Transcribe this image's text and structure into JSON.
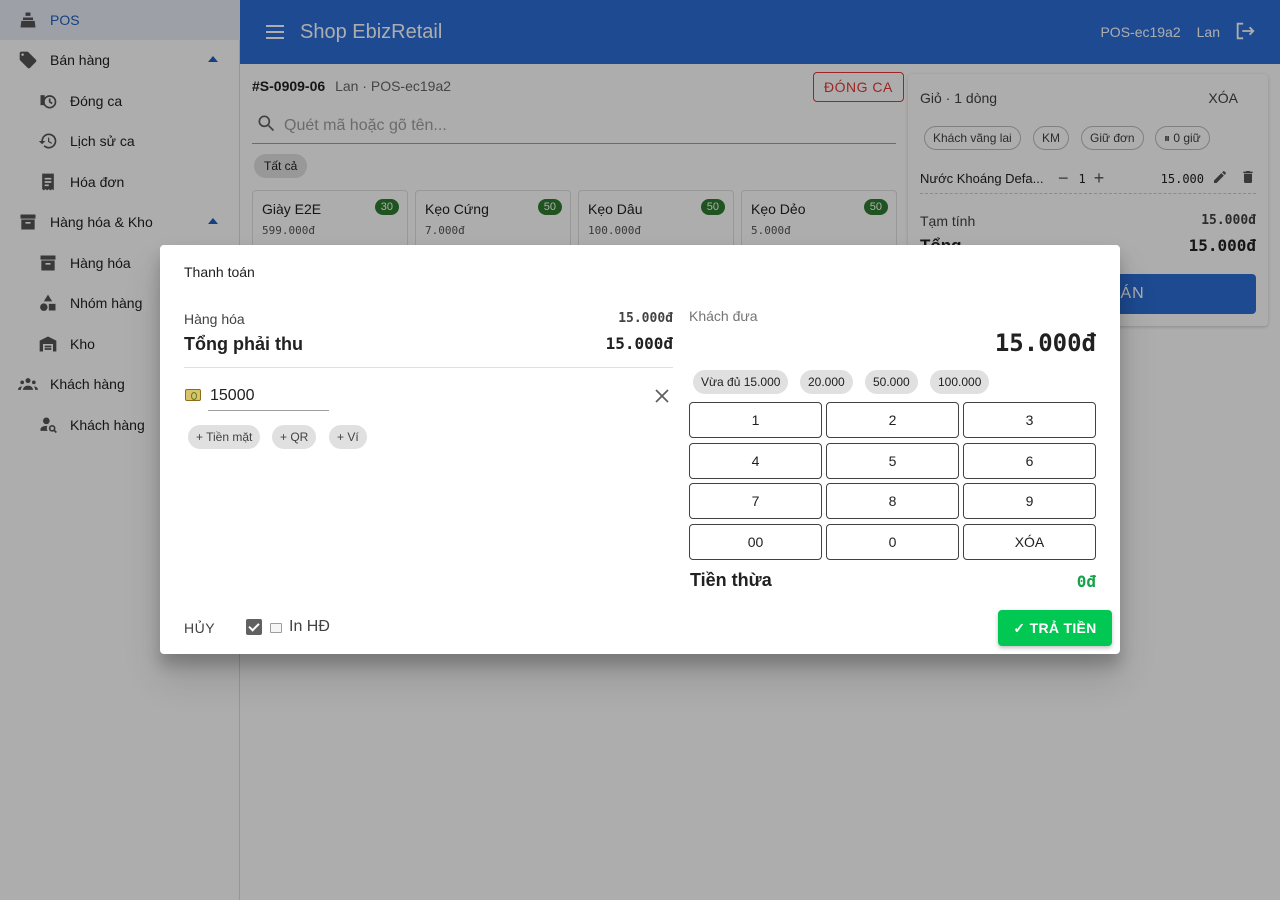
{
  "sidebar": {
    "pos": "POS",
    "sales": "Bán hàng",
    "close_shift": "Đóng ca",
    "shift_history": "Lịch sử ca",
    "invoices": "Hóa đơn",
    "goods_stock": "Hàng hóa & Kho",
    "goods": "Hàng hóa",
    "groups": "Nhóm hàng",
    "warehouse": "Kho",
    "customers_group": "Khách hàng",
    "customers": "Khách hàng"
  },
  "appbar": {
    "title": "Shop EbizRetail",
    "terminal": "POS-ec19a2",
    "user": "Lan"
  },
  "order": {
    "code": "#S-0909-06",
    "meta": "Lan · POS-ec19a2",
    "close_shift_btn": "ĐÓNG CA"
  },
  "search": {
    "placeholder": "Quét mã hoặc gõ tên..."
  },
  "filter": {
    "all": "Tất cả"
  },
  "products": [
    {
      "name": "Giày E2E",
      "price": "599.000đ",
      "stock": "30"
    },
    {
      "name": "Kẹo Cứng",
      "price": "7.000đ",
      "stock": "50"
    },
    {
      "name": "Kẹo Dâu",
      "price": "100.000đ",
      "stock": "50"
    },
    {
      "name": "Kẹo Dẻo",
      "price": "5.000đ",
      "stock": "50"
    }
  ],
  "cart": {
    "title": "Giỏ · 1 dòng",
    "clear": "XÓA",
    "chips": [
      "Khách vãng lai",
      "KM",
      "Giữ đơn",
      "⏸ 0 giữ"
    ],
    "line": {
      "name": "Nước Khoáng Defa...",
      "qty": "1",
      "price": "15.000"
    },
    "subtotal_label": "Tạm tính",
    "subtotal": "15.000đ",
    "total_label": "Tổng",
    "total": "15.000đ",
    "checkout": "THANH TOÁN"
  },
  "dialog": {
    "title": "Thanh toán",
    "goods_label": "Hàng hóa",
    "goods_value": "15.000đ",
    "total_label": "Tổng phải thu",
    "total_value": "15.000đ",
    "cash_value": "15000",
    "methods": [
      "+ Tiền mặt",
      "+ QR",
      "+ Ví"
    ],
    "given_label": "Khách đưa",
    "given_amount": "15.000đ",
    "quick": [
      "Vừa đủ 15.000",
      "20.000",
      "50.000",
      "100.000"
    ],
    "keys": [
      "1",
      "2",
      "3",
      "4",
      "5",
      "6",
      "7",
      "8",
      "9",
      "00",
      "0",
      "XÓA"
    ],
    "change_label": "Tiền thừa",
    "change_value": "0đ",
    "cancel": "HỦY",
    "print": "In HĐ",
    "pay": "✓ TRẢ TIỀN"
  },
  "colors": {
    "primary": "#2c6ed5",
    "danger": "#e53935",
    "success": "#00c853",
    "stock_badge": "#2e7d32"
  }
}
